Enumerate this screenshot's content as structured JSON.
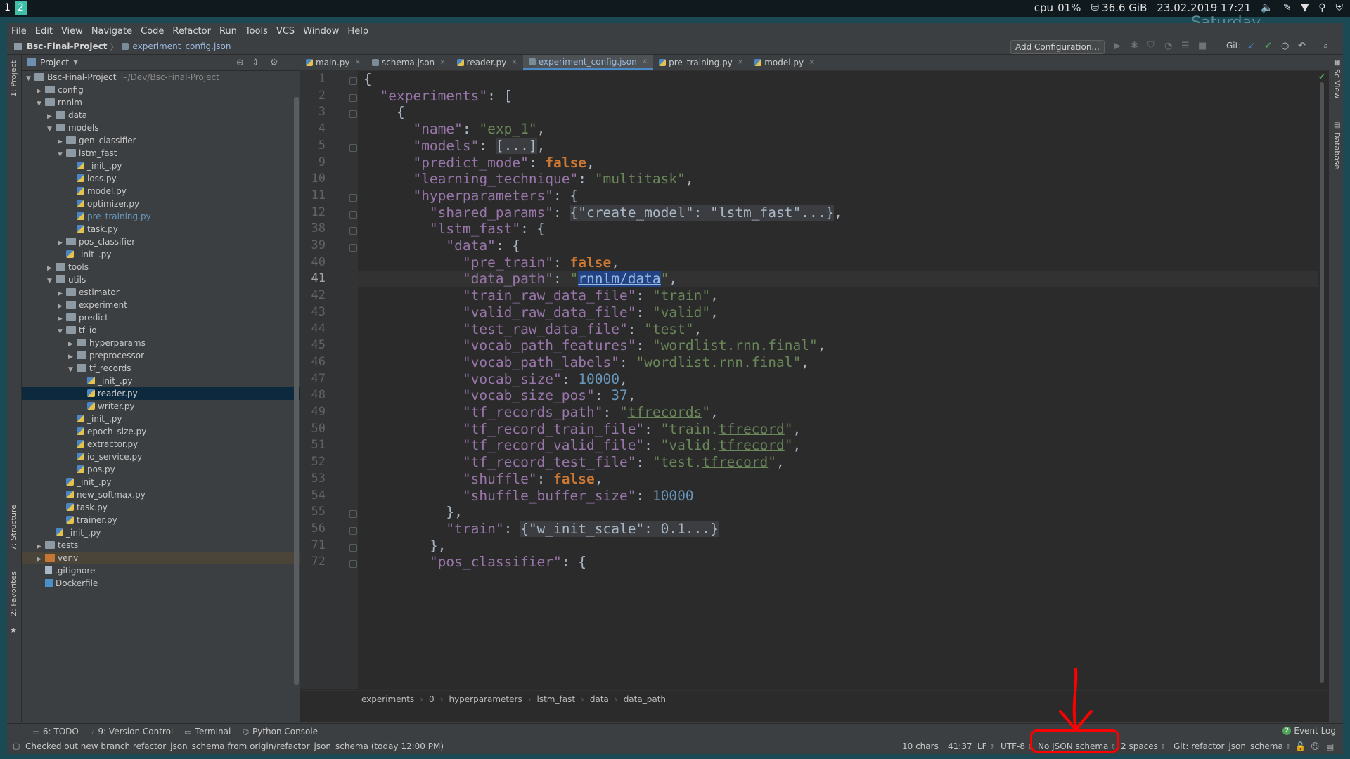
{
  "desktop": {
    "workspaces": [
      "1",
      "2"
    ],
    "cpu_label": "cpu",
    "cpu_value": "01%",
    "disk": "36.6 GiB",
    "datetime": "23.02.2019 17:21",
    "day": "Saturday"
  },
  "menu": [
    "File",
    "Edit",
    "View",
    "Navigate",
    "Code",
    "Refactor",
    "Run",
    "Tools",
    "VCS",
    "Window",
    "Help"
  ],
  "navbar": {
    "project": "Bsc-Final-Project",
    "file": "experiment_config.json",
    "add_configuration": "Add Configuration...",
    "git_label": "Git:"
  },
  "project_panel": {
    "title": "Project",
    "tree": [
      {
        "label": "Bsc-Final-Project",
        "hint": "~/Dev/Bsc-Final-Project",
        "depth": 0,
        "kind": "folder",
        "arrow": "open"
      },
      {
        "label": "config",
        "depth": 1,
        "kind": "folder",
        "arrow": "closed"
      },
      {
        "label": "rnnlm",
        "depth": 1,
        "kind": "folder",
        "arrow": "open"
      },
      {
        "label": "data",
        "depth": 2,
        "kind": "folder",
        "arrow": "closed"
      },
      {
        "label": "models",
        "depth": 2,
        "kind": "folder",
        "arrow": "open"
      },
      {
        "label": "gen_classifier",
        "depth": 3,
        "kind": "folder",
        "arrow": "closed"
      },
      {
        "label": "lstm_fast",
        "depth": 3,
        "kind": "folder",
        "arrow": "open"
      },
      {
        "label": "_init_.py",
        "depth": 4,
        "kind": "py"
      },
      {
        "label": "loss.py",
        "depth": 4,
        "kind": "py"
      },
      {
        "label": "model.py",
        "depth": 4,
        "kind": "py"
      },
      {
        "label": "optimizer.py",
        "depth": 4,
        "kind": "py"
      },
      {
        "label": "pre_training.py",
        "depth": 4,
        "kind": "py",
        "modified": true
      },
      {
        "label": "task.py",
        "depth": 4,
        "kind": "py"
      },
      {
        "label": "pos_classifier",
        "depth": 3,
        "kind": "folder",
        "arrow": "closed"
      },
      {
        "label": "_init_.py",
        "depth": 3,
        "kind": "py"
      },
      {
        "label": "tools",
        "depth": 2,
        "kind": "folder",
        "arrow": "closed"
      },
      {
        "label": "utils",
        "depth": 2,
        "kind": "folder",
        "arrow": "open"
      },
      {
        "label": "estimator",
        "depth": 3,
        "kind": "folder",
        "arrow": "closed"
      },
      {
        "label": "experiment",
        "depth": 3,
        "kind": "folder",
        "arrow": "closed"
      },
      {
        "label": "predict",
        "depth": 3,
        "kind": "folder",
        "arrow": "closed"
      },
      {
        "label": "tf_io",
        "depth": 3,
        "kind": "folder",
        "arrow": "open"
      },
      {
        "label": "hyperparams",
        "depth": 4,
        "kind": "folder",
        "arrow": "closed"
      },
      {
        "label": "preprocessor",
        "depth": 4,
        "kind": "folder",
        "arrow": "closed"
      },
      {
        "label": "tf_records",
        "depth": 4,
        "kind": "folder",
        "arrow": "open"
      },
      {
        "label": "_init_.py",
        "depth": 5,
        "kind": "py"
      },
      {
        "label": "reader.py",
        "depth": 5,
        "kind": "py",
        "selected": true
      },
      {
        "label": "writer.py",
        "depth": 5,
        "kind": "py"
      },
      {
        "label": "_init_.py",
        "depth": 4,
        "kind": "py"
      },
      {
        "label": "epoch_size.py",
        "depth": 4,
        "kind": "py"
      },
      {
        "label": "extractor.py",
        "depth": 4,
        "kind": "py"
      },
      {
        "label": "io_service.py",
        "depth": 4,
        "kind": "py"
      },
      {
        "label": "pos.py",
        "depth": 4,
        "kind": "py"
      },
      {
        "label": "_init_.py",
        "depth": 3,
        "kind": "py"
      },
      {
        "label": "new_softmax.py",
        "depth": 3,
        "kind": "py"
      },
      {
        "label": "task.py",
        "depth": 3,
        "kind": "py"
      },
      {
        "label": "trainer.py",
        "depth": 3,
        "kind": "py"
      },
      {
        "label": "_init_.py",
        "depth": 2,
        "kind": "py"
      },
      {
        "label": "tests",
        "depth": 1,
        "kind": "folder",
        "arrow": "closed"
      },
      {
        "label": "venv",
        "depth": 1,
        "kind": "folder-orange",
        "arrow": "closed",
        "highlight": true
      },
      {
        "label": ".gitignore",
        "depth": 1,
        "kind": "plain"
      },
      {
        "label": "Dockerfile",
        "depth": 1,
        "kind": "docker"
      }
    ]
  },
  "tabs": [
    {
      "label": "main.py",
      "type": "py"
    },
    {
      "label": "schema.json",
      "type": "json"
    },
    {
      "label": "reader.py",
      "type": "py"
    },
    {
      "label": "experiment_config.json",
      "type": "json",
      "active": true
    },
    {
      "label": "pre_training.py",
      "type": "py"
    },
    {
      "label": "model.py",
      "type": "py"
    }
  ],
  "editor": {
    "lines": [
      {
        "num": "1",
        "fold": true,
        "tokens": [
          [
            "p",
            "{"
          ]
        ]
      },
      {
        "num": "2",
        "fold": true,
        "tokens": [
          [
            "p",
            "  "
          ],
          [
            "k",
            "\"experiments\""
          ],
          [
            "p",
            ": ["
          ]
        ]
      },
      {
        "num": "3",
        "fold": true,
        "tokens": [
          [
            "p",
            "    {"
          ]
        ]
      },
      {
        "num": "4",
        "tokens": [
          [
            "p",
            "      "
          ],
          [
            "k",
            "\"name\""
          ],
          [
            "p",
            ": "
          ],
          [
            "s",
            "\"exp_1\""
          ],
          [
            "p",
            ","
          ]
        ]
      },
      {
        "num": "5",
        "fold": true,
        "tokens": [
          [
            "p",
            "      "
          ],
          [
            "k",
            "\"models\""
          ],
          [
            "p",
            ": "
          ],
          [
            "fd",
            "[...]"
          ],
          [
            "p",
            ","
          ]
        ]
      },
      {
        "num": "9",
        "tokens": [
          [
            "p",
            "      "
          ],
          [
            "k",
            "\"predict_mode\""
          ],
          [
            "p",
            ": "
          ],
          [
            "b",
            "false"
          ],
          [
            "p",
            ","
          ]
        ]
      },
      {
        "num": "10",
        "tokens": [
          [
            "p",
            "      "
          ],
          [
            "k",
            "\"learning_technique\""
          ],
          [
            "p",
            ": "
          ],
          [
            "s",
            "\"multitask\""
          ],
          [
            "p",
            ","
          ]
        ]
      },
      {
        "num": "11",
        "fold": true,
        "tokens": [
          [
            "p",
            "      "
          ],
          [
            "k",
            "\"hyperparameters\""
          ],
          [
            "p",
            ": {"
          ]
        ]
      },
      {
        "num": "12",
        "fold": true,
        "tokens": [
          [
            "p",
            "        "
          ],
          [
            "k",
            "\"shared_params\""
          ],
          [
            "p",
            ": "
          ],
          [
            "fd",
            "{\"create_model\": \"lstm_fast\"...}"
          ],
          [
            "p",
            ","
          ]
        ]
      },
      {
        "num": "38",
        "fold": true,
        "tokens": [
          [
            "p",
            "        "
          ],
          [
            "k",
            "\"lstm_fast\""
          ],
          [
            "p",
            ": {"
          ]
        ]
      },
      {
        "num": "39",
        "fold": true,
        "tokens": [
          [
            "p",
            "          "
          ],
          [
            "k",
            "\"data\""
          ],
          [
            "p",
            ": {"
          ]
        ]
      },
      {
        "num": "40",
        "tokens": [
          [
            "p",
            "            "
          ],
          [
            "k",
            "\"pre_train\""
          ],
          [
            "p",
            ": "
          ],
          [
            "b",
            "false"
          ],
          [
            "p",
            ","
          ]
        ]
      },
      {
        "num": "41",
        "current": true,
        "tokens": [
          [
            "p",
            "            "
          ],
          [
            "k",
            "\"data_path\""
          ],
          [
            "p",
            ": "
          ],
          [
            "s",
            "\""
          ],
          [
            "sel",
            "rnnlm/data"
          ],
          [
            "s",
            "\""
          ],
          [
            "p",
            ","
          ]
        ]
      },
      {
        "num": "42",
        "tokens": [
          [
            "p",
            "            "
          ],
          [
            "k",
            "\"train_raw_data_file\""
          ],
          [
            "p",
            ": "
          ],
          [
            "s",
            "\"train\""
          ],
          [
            "p",
            ","
          ]
        ]
      },
      {
        "num": "43",
        "tokens": [
          [
            "p",
            "            "
          ],
          [
            "k",
            "\"valid_raw_data_file\""
          ],
          [
            "p",
            ": "
          ],
          [
            "s",
            "\"valid\""
          ],
          [
            "p",
            ","
          ]
        ]
      },
      {
        "num": "44",
        "tokens": [
          [
            "p",
            "            "
          ],
          [
            "k",
            "\"test_raw_data_file\""
          ],
          [
            "p",
            ": "
          ],
          [
            "s",
            "\"test\""
          ],
          [
            "p",
            ","
          ]
        ]
      },
      {
        "num": "45",
        "tokens": [
          [
            "p",
            "            "
          ],
          [
            "k",
            "\"vocab_path_features\""
          ],
          [
            "p",
            ": "
          ],
          [
            "s",
            "\""
          ],
          [
            "su",
            "wordlist"
          ],
          [
            "s",
            ".rnn.final\""
          ],
          [
            "p",
            ","
          ]
        ]
      },
      {
        "num": "46",
        "tokens": [
          [
            "p",
            "            "
          ],
          [
            "k",
            "\"vocab_path_labels\""
          ],
          [
            "p",
            ": "
          ],
          [
            "s",
            "\""
          ],
          [
            "su",
            "wordlist"
          ],
          [
            "s",
            ".rnn.final\""
          ],
          [
            "p",
            ","
          ]
        ]
      },
      {
        "num": "47",
        "tokens": [
          [
            "p",
            "            "
          ],
          [
            "k",
            "\"vocab_size\""
          ],
          [
            "p",
            ": "
          ],
          [
            "n",
            "10000"
          ],
          [
            "p",
            ","
          ]
        ]
      },
      {
        "num": "48",
        "tokens": [
          [
            "p",
            "            "
          ],
          [
            "k",
            "\"vocab_size_pos\""
          ],
          [
            "p",
            ": "
          ],
          [
            "n",
            "37"
          ],
          [
            "p",
            ","
          ]
        ]
      },
      {
        "num": "49",
        "tokens": [
          [
            "p",
            "            "
          ],
          [
            "k",
            "\"tf_records_path\""
          ],
          [
            "p",
            ": "
          ],
          [
            "s",
            "\""
          ],
          [
            "su",
            "tfrecords"
          ],
          [
            "s",
            "\""
          ],
          [
            "p",
            ","
          ]
        ]
      },
      {
        "num": "50",
        "tokens": [
          [
            "p",
            "            "
          ],
          [
            "k",
            "\"tf_record_train_file\""
          ],
          [
            "p",
            ": "
          ],
          [
            "s",
            "\"train."
          ],
          [
            "su",
            "tfrecord"
          ],
          [
            "s",
            "\""
          ],
          [
            "p",
            ","
          ]
        ]
      },
      {
        "num": "51",
        "tokens": [
          [
            "p",
            "            "
          ],
          [
            "k",
            "\"tf_record_valid_file\""
          ],
          [
            "p",
            ": "
          ],
          [
            "s",
            "\"valid."
          ],
          [
            "su",
            "tfrecord"
          ],
          [
            "s",
            "\""
          ],
          [
            "p",
            ","
          ]
        ]
      },
      {
        "num": "52",
        "tokens": [
          [
            "p",
            "            "
          ],
          [
            "k",
            "\"tf_record_test_file\""
          ],
          [
            "p",
            ": "
          ],
          [
            "s",
            "\"test."
          ],
          [
            "su",
            "tfrecord"
          ],
          [
            "s",
            "\""
          ],
          [
            "p",
            ","
          ]
        ]
      },
      {
        "num": "53",
        "tokens": [
          [
            "p",
            "            "
          ],
          [
            "k",
            "\"shuffle\""
          ],
          [
            "p",
            ": "
          ],
          [
            "b",
            "false"
          ],
          [
            "p",
            ","
          ]
        ]
      },
      {
        "num": "54",
        "tokens": [
          [
            "p",
            "            "
          ],
          [
            "k",
            "\"shuffle_buffer_size\""
          ],
          [
            "p",
            ": "
          ],
          [
            "n",
            "10000"
          ]
        ]
      },
      {
        "num": "55",
        "fold": true,
        "tokens": [
          [
            "p",
            "          },"
          ]
        ]
      },
      {
        "num": "56",
        "fold": true,
        "tokens": [
          [
            "p",
            "          "
          ],
          [
            "k",
            "\"train\""
          ],
          [
            "p",
            ": "
          ],
          [
            "fd",
            "{\"w_init_scale\": 0.1...}"
          ]
        ]
      },
      {
        "num": "71",
        "fold": true,
        "tokens": [
          [
            "p",
            "        },"
          ]
        ]
      },
      {
        "num": "72",
        "fold": true,
        "tokens": [
          [
            "p",
            "        "
          ],
          [
            "k",
            "\"pos_classifier\""
          ],
          [
            "p",
            ": {"
          ]
        ]
      }
    ]
  },
  "breadcrumbs": [
    "experiments",
    "0",
    "hyperparameters",
    "lstm_fast",
    "data",
    "data_path"
  ],
  "side_tabs": {
    "project": "1: Project",
    "structure": "7: Structure",
    "favorites": "2: Favorites",
    "sciview": "SciView",
    "database": "Database"
  },
  "tool_windows": [
    {
      "label": "6: TODO",
      "icon": "todo-icon"
    },
    {
      "label": "9: Version Control",
      "icon": "version-control-icon"
    },
    {
      "label": "Terminal",
      "icon": "terminal-icon"
    },
    {
      "label": "Python Console",
      "icon": "python-console-icon"
    }
  ],
  "event_log": {
    "label": "Event Log",
    "count": "2"
  },
  "status": {
    "message": "Checked out new branch refactor_json_schema from origin/refactor_json_schema (today 12:00 PM)",
    "chars": "10 chars",
    "position": "41:37",
    "line_sep": "LF",
    "encoding": "UTF-8",
    "schema": "No JSON schema",
    "indent": "2 spaces",
    "git_branch": "Git: refactor_json_schema"
  }
}
